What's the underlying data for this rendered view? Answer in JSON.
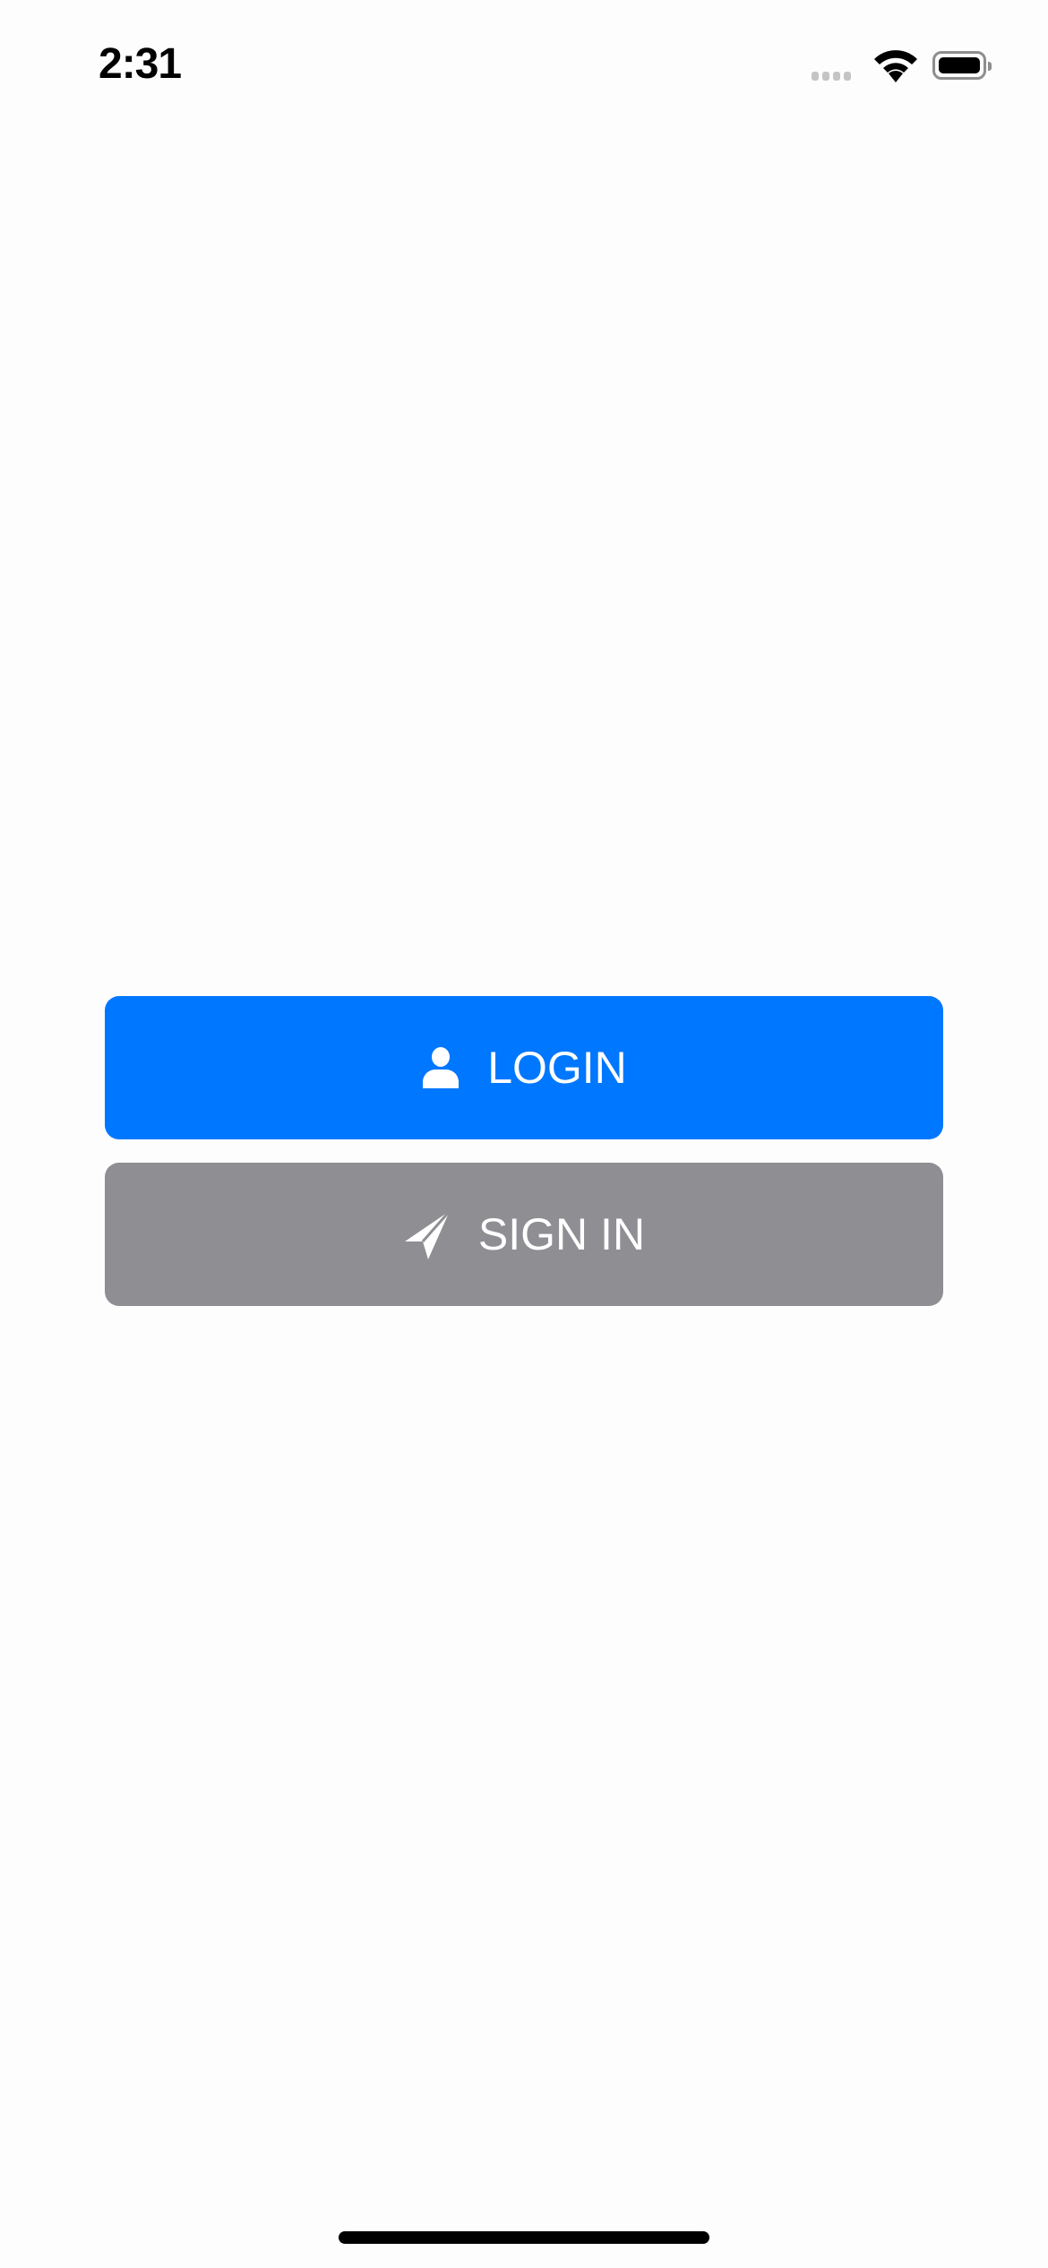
{
  "status_bar": {
    "time": "2:31",
    "icons": [
      "signal-icon",
      "wifi-icon",
      "battery-icon"
    ]
  },
  "buttons": {
    "login": {
      "label": "LOGIN",
      "icon": "person-icon",
      "color": "#0077FF"
    },
    "signin": {
      "label": "SIGN IN",
      "icon": "paper-plane-icon",
      "color": "#8E8E93"
    }
  }
}
